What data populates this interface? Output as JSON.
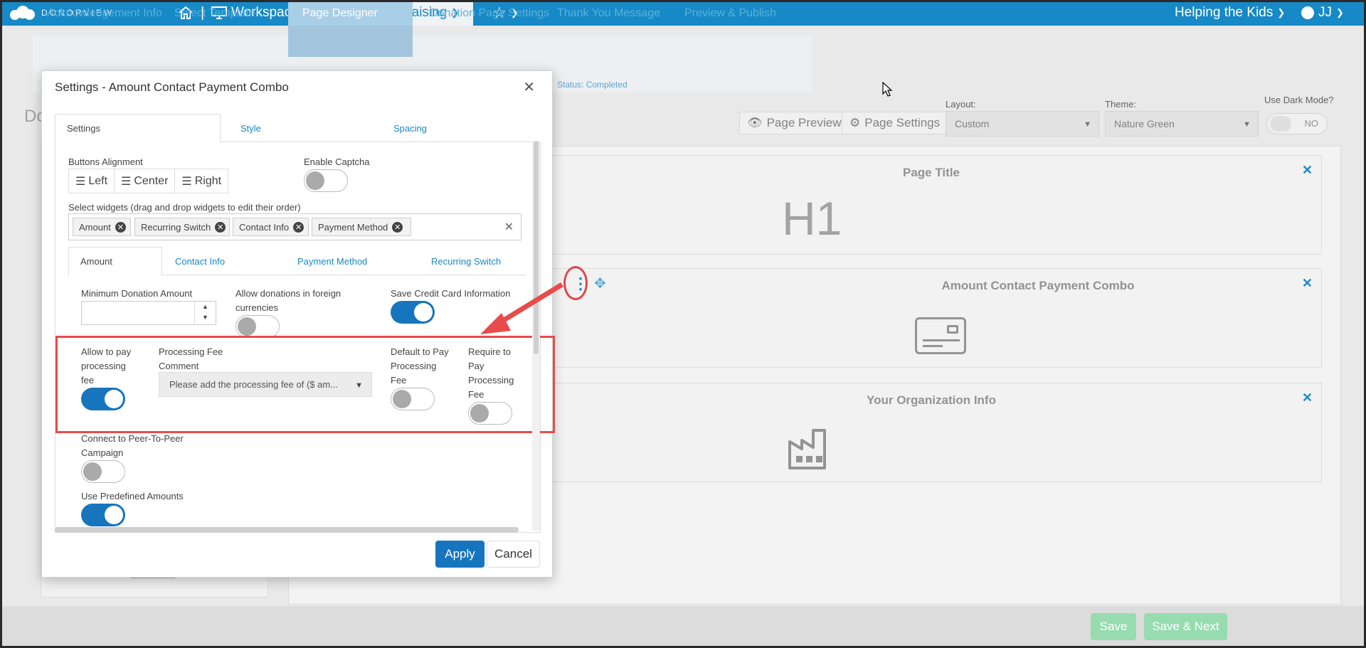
{
  "nav": {
    "logo_text": "DONORVIEW",
    "workspace": "Workspace",
    "fundraising": "Fundraising",
    "org": "Helping the Kids",
    "user": "JJ"
  },
  "steps": {
    "items": [
      "Acknowledgement Info",
      "Select Template",
      "Page Designer",
      "Donation Page Settings",
      "Thank You Message",
      "Preview & Publish"
    ],
    "status": "Status: Completed"
  },
  "toolbar": {
    "page_preview": "Page Preview",
    "page_settings": "Page Settings",
    "layout_label": "Layout:",
    "layout_value": "Custom",
    "theme_label": "Theme:",
    "theme_value": "Nature Green",
    "dark_mode_label": "Use Dark Mode?",
    "dark_mode_value": "NO"
  },
  "canvas": {
    "page_title": "Page Title",
    "h1": "H1",
    "combo_title": "Amount Contact Payment Combo",
    "org_info": "Your Organization Info",
    "left_fragment": "Do"
  },
  "modal": {
    "title": "Settings - Amount Contact Payment Combo",
    "tabs": [
      "Settings",
      "Style",
      "Spacing"
    ],
    "buttons_alignment_label": "Buttons Alignment",
    "align_left": "Left",
    "align_center": "Center",
    "align_right": "Right",
    "enable_captcha_label": "Enable Captcha",
    "select_widgets_label": "Select widgets (drag and drop widgets to edit their order)",
    "chips": [
      "Amount",
      "Recurring Switch",
      "Contact Info",
      "Payment Method"
    ],
    "subtabs": [
      "Amount",
      "Contact Info",
      "Payment Method",
      "Recurring Switch"
    ],
    "min_donation_label": "Minimum Donation Amount",
    "foreign_currencies_label_1": "Allow donations in foreign",
    "foreign_currencies_label_2": "currencies",
    "save_cc_label": "Save Credit Card Information",
    "allow_pay_1": "Allow to pay",
    "allow_pay_2": "processing",
    "allow_pay_3": "fee",
    "fee_comment_1": "Processing Fee",
    "fee_comment_2": "Comment",
    "fee_comment_value": "Please add the processing fee of ($ am...",
    "default_pay_1": "Default to Pay",
    "default_pay_2": "Processing",
    "default_pay_3": "Fee",
    "require_pay_1": "Require to",
    "require_pay_2": "Pay",
    "require_pay_3": "Processing",
    "require_pay_4": "Fee",
    "p2p_1": "Connect to Peer-To-Peer",
    "p2p_2": "Campaign",
    "predefined_label": "Use Predefined Amounts",
    "apply": "Apply",
    "cancel": "Cancel"
  },
  "bottom": {
    "save": "Save",
    "save_next": "Save & Next"
  },
  "colors": {
    "nav_blue": "#1789c6",
    "primary": "#1775bd",
    "highlight_red": "#e84b4b",
    "save_green": "#96dcaf"
  }
}
